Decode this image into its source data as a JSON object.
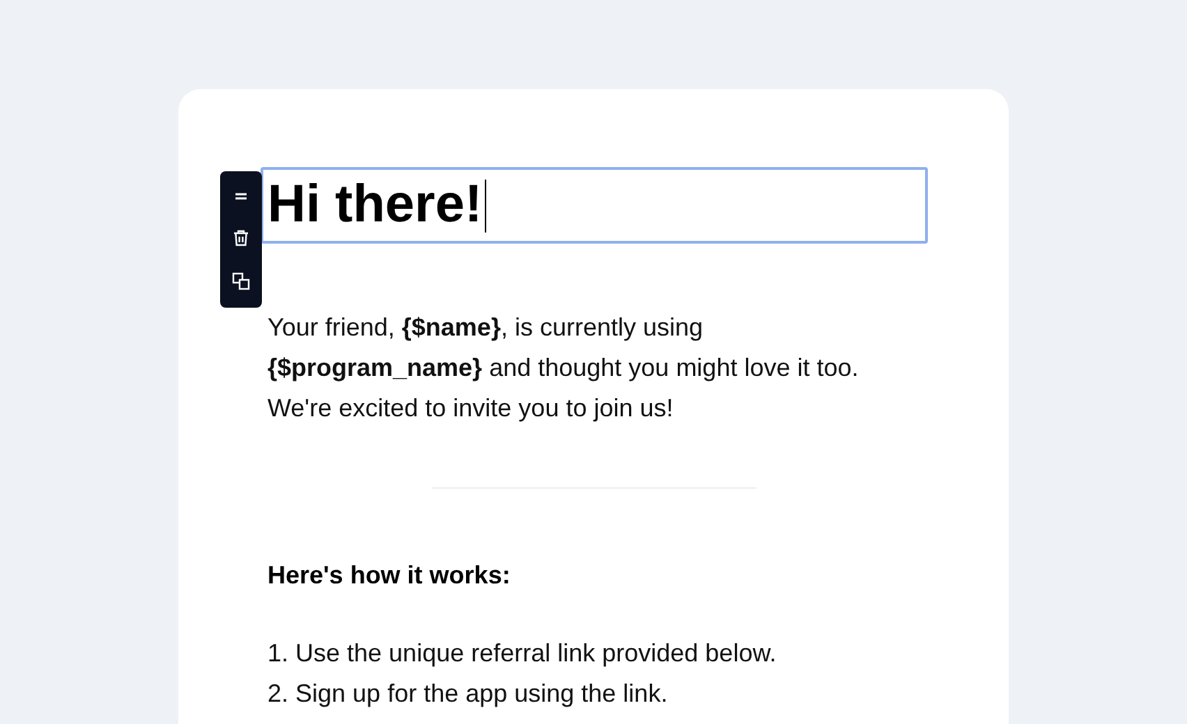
{
  "editor": {
    "heading": {
      "value": "Hi there!",
      "focused": true
    },
    "toolbar": [
      {
        "kind": "drag"
      },
      {
        "kind": "delete"
      },
      {
        "kind": "duplicate"
      }
    ],
    "paragraph": "Your friend, **{$name}**, is currently using **{$program_name}** and thought you might love it too. We're excited to invite you to join us!",
    "subheading": "Here's how it works:",
    "steps": [
      "1. Use the unique referral link provided below.",
      "2. Sign up for the app using the link."
    ]
  }
}
